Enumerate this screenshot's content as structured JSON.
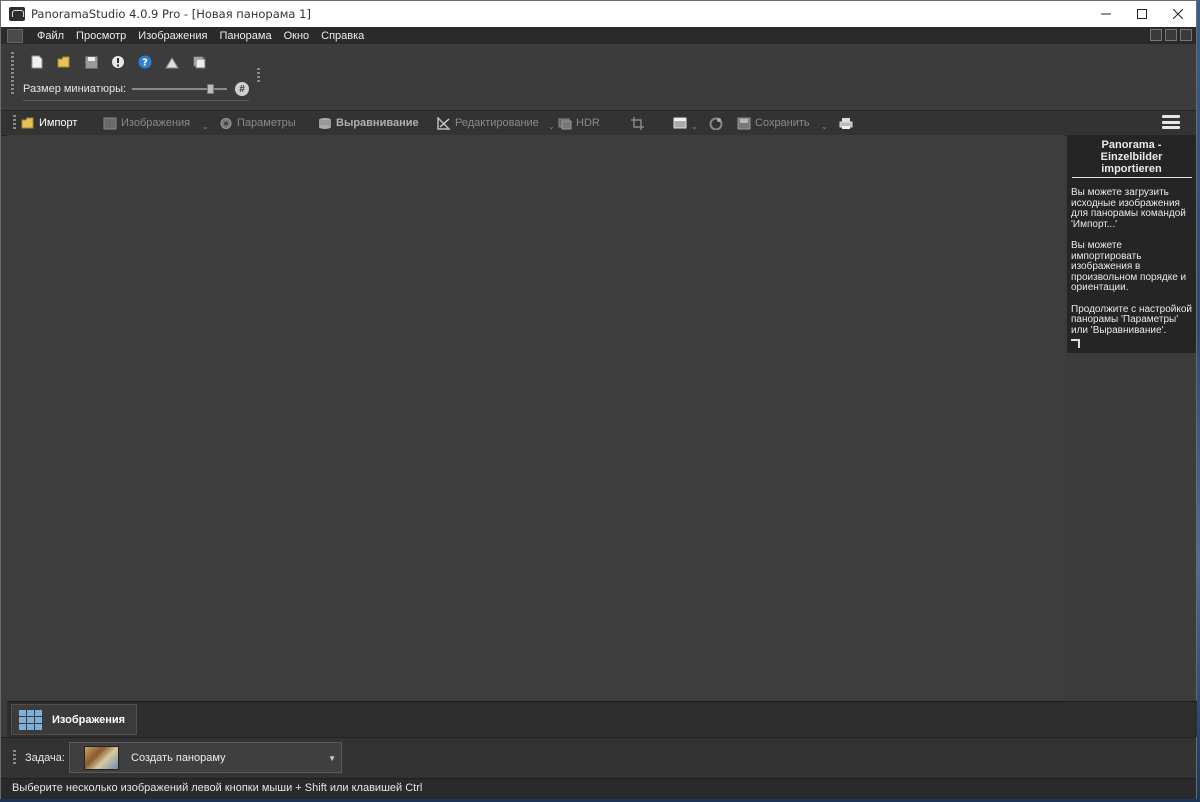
{
  "window": {
    "title": "PanoramaStudio 4.0.9 Pro - [Новая панорама 1]",
    "controls": [
      "minimize",
      "maximize",
      "close"
    ]
  },
  "menu": {
    "items": [
      "Файл",
      "Просмотр",
      "Изображения",
      "Панорама",
      "Окно",
      "Справка"
    ]
  },
  "tools": {
    "icons": [
      "new-document-icon",
      "open-folder-icon",
      "save-icon",
      "tip-icon",
      "help-icon",
      "export-icon",
      "batch-icon"
    ],
    "thumbnail_label": "Размер миниатюры:",
    "thumbnail_size": 0.85,
    "grid_button": "#"
  },
  "workflow": {
    "import": "Импорт",
    "images": "Изображения",
    "parameters": "Параметры",
    "alignment": "Выравнивание",
    "editing": "Редактирование",
    "hdr": "HDR",
    "save": "Сохранить"
  },
  "help": {
    "title": "Panorama - Einzelbilder importieren",
    "p1": "Вы можете загрузить исходные изображения для панорамы командой 'Импорт...'",
    "p2": "Вы можете импортировать изображения в произвольном порядке и ориентации.",
    "p3": "Продолжите с настройкой панорамы 'Параметры' или 'Выравнивание'."
  },
  "bottom_tab": {
    "label": "Изображения"
  },
  "task": {
    "label": "Задача:",
    "selected": "Создать панораму"
  },
  "status": {
    "text": "Выберите несколько изображений левой кнопки мыши + Shift или клавишей Ctrl"
  },
  "colors": {
    "workspace": "#3d3d3d",
    "help_panel": "#252525",
    "accent_blue": "#7fb0d8"
  }
}
